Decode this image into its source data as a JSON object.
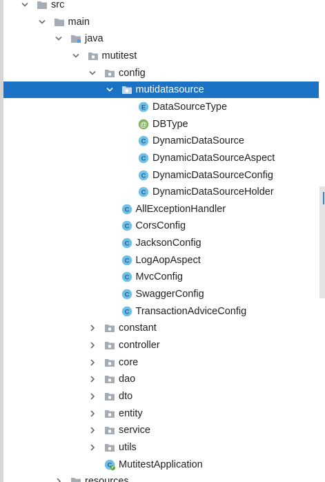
{
  "tree": {
    "items": [
      {
        "label": "src",
        "level": 0,
        "kind": "folder",
        "expanded": true
      },
      {
        "label": "main",
        "level": 1,
        "kind": "folder",
        "expanded": true
      },
      {
        "label": "java",
        "level": 2,
        "kind": "source-folder",
        "expanded": true
      },
      {
        "label": "mutitest",
        "level": 3,
        "kind": "package",
        "expanded": true
      },
      {
        "label": "config",
        "level": 4,
        "kind": "package",
        "expanded": true
      },
      {
        "label": "mutidatasource",
        "level": 5,
        "kind": "package",
        "expanded": true,
        "selected": true
      },
      {
        "label": "DataSourceType",
        "level": 6,
        "kind": "enum",
        "glyph": "E"
      },
      {
        "label": "DBType",
        "level": 6,
        "kind": "annotation",
        "glyph": "@"
      },
      {
        "label": "DynamicDataSource",
        "level": 6,
        "kind": "class",
        "glyph": "C"
      },
      {
        "label": "DynamicDataSourceAspect",
        "level": 6,
        "kind": "class",
        "glyph": "C"
      },
      {
        "label": "DynamicDataSourceConfig",
        "level": 6,
        "kind": "class",
        "glyph": "C"
      },
      {
        "label": "DynamicDataSourceHolder",
        "level": 6,
        "kind": "class",
        "glyph": "C"
      },
      {
        "label": "AllExceptionHandler",
        "level": 5,
        "kind": "class",
        "glyph": "C"
      },
      {
        "label": "CorsConfig",
        "level": 5,
        "kind": "class",
        "glyph": "C"
      },
      {
        "label": "JacksonConfig",
        "level": 5,
        "kind": "class",
        "glyph": "C"
      },
      {
        "label": "LogAopAspect",
        "level": 5,
        "kind": "class",
        "glyph": "C"
      },
      {
        "label": "MvcConfig",
        "level": 5,
        "kind": "class",
        "glyph": "C"
      },
      {
        "label": "SwaggerConfig",
        "level": 5,
        "kind": "class",
        "glyph": "C"
      },
      {
        "label": "TransactionAdviceConfig",
        "level": 5,
        "kind": "class",
        "glyph": "C"
      },
      {
        "label": "constant",
        "level": 4,
        "kind": "package",
        "expanded": false
      },
      {
        "label": "controller",
        "level": 4,
        "kind": "package",
        "expanded": false
      },
      {
        "label": "core",
        "level": 4,
        "kind": "package",
        "expanded": false
      },
      {
        "label": "dao",
        "level": 4,
        "kind": "package",
        "expanded": false
      },
      {
        "label": "dto",
        "level": 4,
        "kind": "package",
        "expanded": false
      },
      {
        "label": "entity",
        "level": 4,
        "kind": "package",
        "expanded": false
      },
      {
        "label": "service",
        "level": 4,
        "kind": "package",
        "expanded": false
      },
      {
        "label": "utils",
        "level": 4,
        "kind": "package",
        "expanded": false
      },
      {
        "label": "MutitestApplication",
        "level": 4,
        "kind": "spring-class",
        "glyph": "C"
      },
      {
        "label": "resources",
        "level": 2,
        "kind": "resource-folder",
        "expanded": false
      }
    ]
  },
  "colors": {
    "selection": "#1c73c6",
    "folder": "#a5acb3",
    "class_icon": "#6fc0e8",
    "annotation_icon": "#82b35a",
    "arrow": "#6a6a6a"
  },
  "icons": {
    "folder": "folder-icon",
    "package": "package-icon",
    "class": "class-icon",
    "enum": "enum-icon",
    "annotation": "annotation-icon",
    "spring-class": "spring-class-icon"
  }
}
